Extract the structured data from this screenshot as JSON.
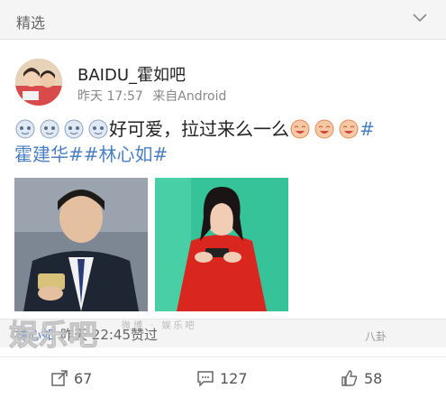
{
  "header": {
    "title": "精选",
    "chevron_icon": "chevron-down-icon"
  },
  "post": {
    "author": "BAIDU_霍如吧",
    "time": "昨天 17:57",
    "source": "来自Android",
    "text": "好可爱，拉过来么一么",
    "hashtags": [
      "#霍建华#",
      "#林心如#"
    ],
    "text_line2": "霍建华##林心如#",
    "leading_emoji": "cloud-face-icon",
    "trailing_emoji": "smiley-face-icon",
    "images": [
      "man-in-suit-with-phone-photo",
      "woman-in-red-costume-with-phone-photo"
    ]
  },
  "comment": {
    "user": "林心如",
    "time_liked": "昨天 22:45赞过"
  },
  "actions": {
    "share_count": "67",
    "comment_count": "127",
    "like_count": "58"
  },
  "watermark": {
    "logo": "娱乐吧",
    "small": "微博 · 娱乐吧",
    "corner": "八卦"
  },
  "colors": {
    "link": "#4a7fc1",
    "topbar_bg": "#f5f5f5"
  }
}
